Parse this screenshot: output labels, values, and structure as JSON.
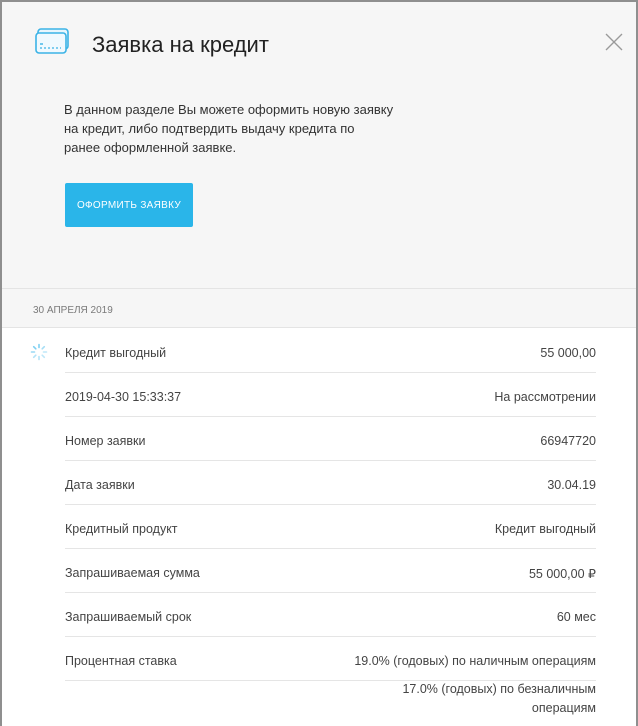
{
  "header": {
    "title": "Заявка на кредит",
    "icon": "credit-card-icon",
    "close_icon": "close-icon"
  },
  "intro": {
    "description": "В данном разделе Вы можете оформить новую заявку на кредит, либо подтвердить выдачу кредита по ранее оформленной заявке.",
    "apply_button": "ОФОРМИТЬ ЗАЯВКУ"
  },
  "application": {
    "date_header": "30 АПРЕЛЯ 2019",
    "status_icon": "loading-spinner-icon",
    "rows": [
      {
        "label": "Кредит выгодный",
        "value": "55 000,00"
      },
      {
        "label": "2019-04-30 15:33:37",
        "value": "На рассмотрении"
      },
      {
        "label": "Номер заявки",
        "value": "66947720"
      },
      {
        "label": "Дата заявки",
        "value": "30.04.19"
      },
      {
        "label": "Кредитный продукт",
        "value": "Кредит выгодный"
      },
      {
        "label": "Запрашиваемая сумма",
        "value": "55 000,00 ₽"
      },
      {
        "label": "Запрашиваемый срок",
        "value": "60 мес"
      },
      {
        "label": "Процентная ставка",
        "value": "19.0% (годовых) по наличным операциям"
      }
    ],
    "rate_extra": "17.0% (годовых) по безналичным операциям"
  },
  "colors": {
    "accent": "#2ab5e9",
    "icon_blue": "#3bb3e6",
    "panel_bg": "#f6f6f6"
  }
}
